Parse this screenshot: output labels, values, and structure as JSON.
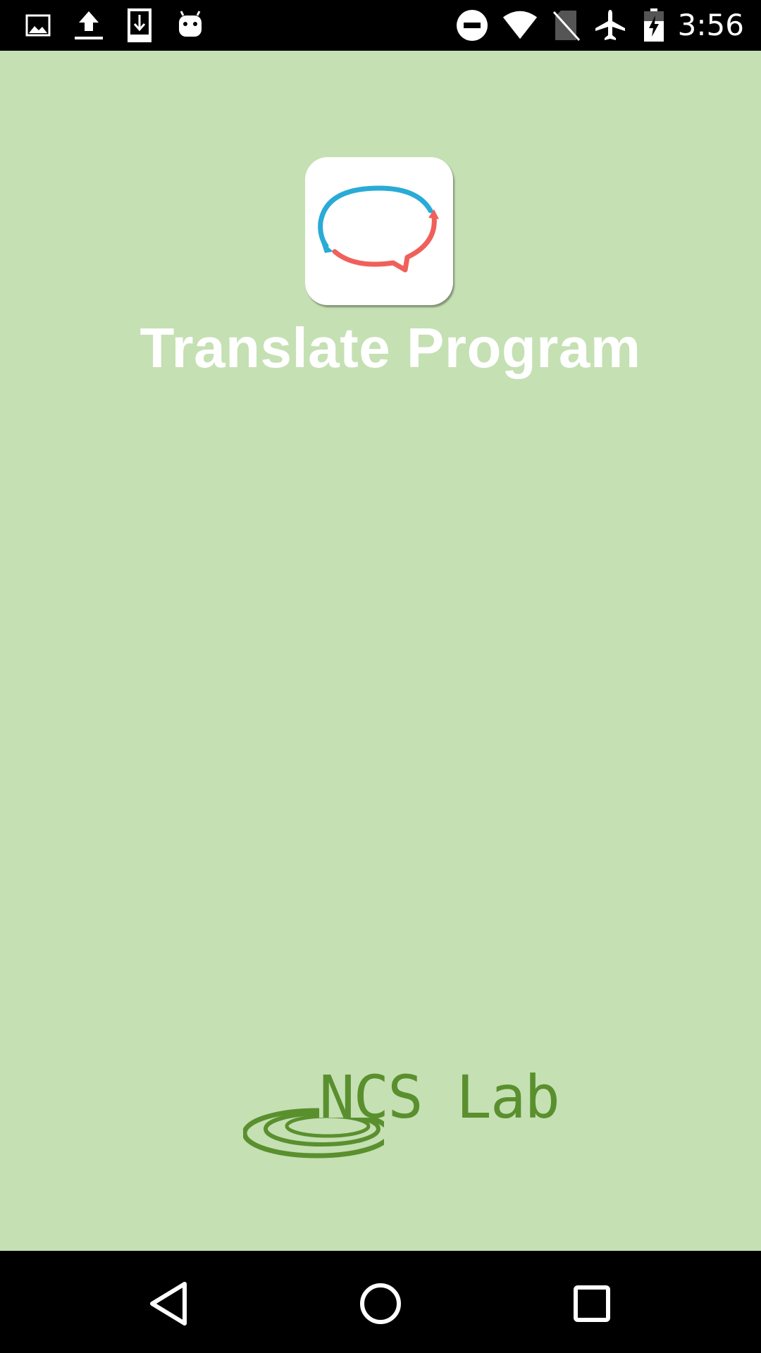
{
  "status_bar": {
    "time": "3:56",
    "left_icons": [
      "image-icon",
      "upload-icon",
      "download-icon",
      "android-icon"
    ],
    "right_icons": [
      "do-not-disturb-icon",
      "wifi-icon",
      "no-sim-icon",
      "airplane-mode-icon",
      "battery-charging-icon"
    ]
  },
  "splash": {
    "app_title": "Translate Program",
    "app_icon": "chat-bubble-translate-icon",
    "brand_name": "NCS Lab"
  },
  "colors": {
    "background": "#c5e0b3",
    "brand_green": "#5a8f2e",
    "bubble_blue": "#29abd6",
    "bubble_red": "#f0605a"
  },
  "nav_bar": {
    "buttons": [
      "back-icon",
      "home-icon",
      "recents-icon"
    ]
  }
}
